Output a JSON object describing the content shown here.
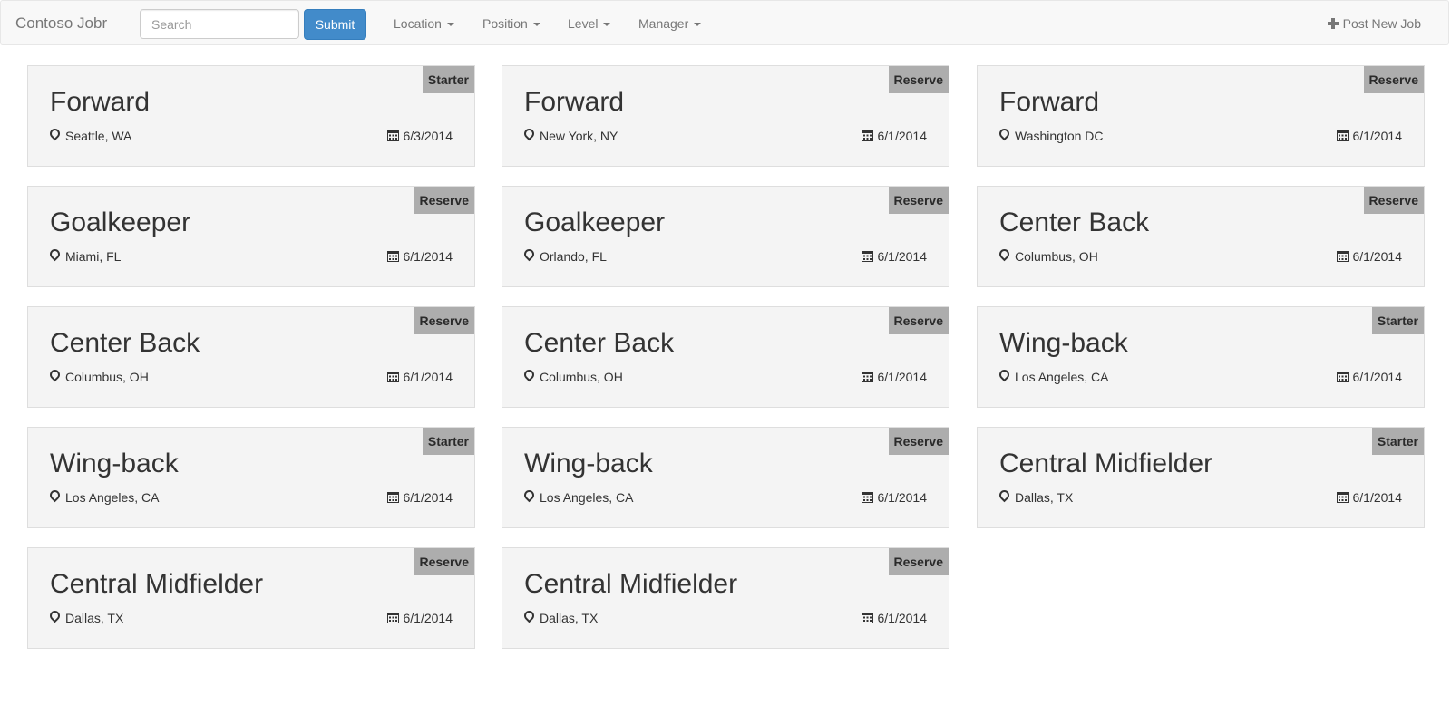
{
  "navbar": {
    "brand": "Contoso Jobr",
    "search_placeholder": "Search",
    "search_value": "",
    "submit_label": "Submit",
    "menus": [
      "Location",
      "Position",
      "Level",
      "Manager"
    ],
    "post_label": "Post New Job"
  },
  "colors": {
    "submit_bg": "#428bca",
    "badge_bg": "#adadad",
    "card_bg": "#f4f4f4"
  },
  "jobs": [
    {
      "title": "Forward",
      "location": "Seattle, WA",
      "date": "6/3/2014",
      "level": "Starter"
    },
    {
      "title": "Forward",
      "location": "New York, NY",
      "date": "6/1/2014",
      "level": "Reserve"
    },
    {
      "title": "Forward",
      "location": "Washington DC",
      "date": "6/1/2014",
      "level": "Reserve"
    },
    {
      "title": "Goalkeeper",
      "location": "Miami, FL",
      "date": "6/1/2014",
      "level": "Reserve"
    },
    {
      "title": "Goalkeeper",
      "location": "Orlando, FL",
      "date": "6/1/2014",
      "level": "Reserve"
    },
    {
      "title": "Center Back",
      "location": "Columbus, OH",
      "date": "6/1/2014",
      "level": "Reserve"
    },
    {
      "title": "Center Back",
      "location": "Columbus, OH",
      "date": "6/1/2014",
      "level": "Reserve"
    },
    {
      "title": "Center Back",
      "location": "Columbus, OH",
      "date": "6/1/2014",
      "level": "Reserve"
    },
    {
      "title": "Wing-back",
      "location": "Los Angeles, CA",
      "date": "6/1/2014",
      "level": "Starter"
    },
    {
      "title": "Wing-back",
      "location": "Los Angeles, CA",
      "date": "6/1/2014",
      "level": "Starter"
    },
    {
      "title": "Wing-back",
      "location": "Los Angeles, CA",
      "date": "6/1/2014",
      "level": "Reserve"
    },
    {
      "title": "Central Midfielder",
      "location": "Dallas, TX",
      "date": "6/1/2014",
      "level": "Starter"
    },
    {
      "title": "Central Midfielder",
      "location": "Dallas, TX",
      "date": "6/1/2014",
      "level": "Reserve"
    },
    {
      "title": "Central Midfielder",
      "location": "Dallas, TX",
      "date": "6/1/2014",
      "level": "Reserve"
    }
  ]
}
